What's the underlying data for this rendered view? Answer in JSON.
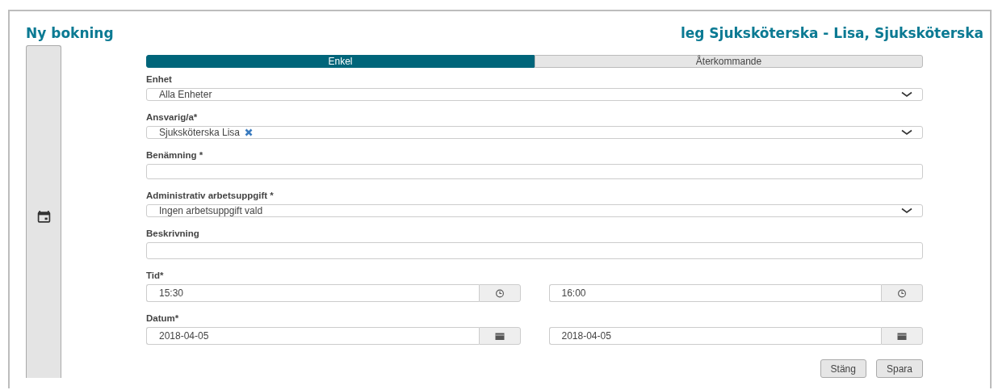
{
  "header": {
    "title": "Ny bokning",
    "user": "leg Sjuksköterska - Lisa, Sjuksköterska"
  },
  "tabs": [
    {
      "label": "Enkel",
      "selected": true
    },
    {
      "label": "Återkommande",
      "selected": false
    }
  ],
  "fields": [
    {
      "kind": "select",
      "label": "Enhet",
      "value": "Alla Enheter"
    },
    {
      "kind": "tag-select",
      "label": "Ansvarig/a*",
      "tags": [
        "Sjuksköterska Lisa"
      ]
    },
    {
      "kind": "text",
      "label": "Benämning *"
    },
    {
      "kind": "select",
      "label": "Administrativ arbetsuppgift *",
      "value": "Ingen arbetsuppgift vald"
    },
    {
      "kind": "textarea",
      "label": "Beskrivning"
    },
    {
      "kind": "time",
      "label": "Tid*",
      "values": [
        "15:30",
        "16:00"
      ]
    },
    {
      "kind": "date",
      "label": "Datum*",
      "values": [
        "2018-04-05",
        "2018-04-05"
      ]
    }
  ],
  "buttons": [
    "Stäng",
    "Spara"
  ]
}
